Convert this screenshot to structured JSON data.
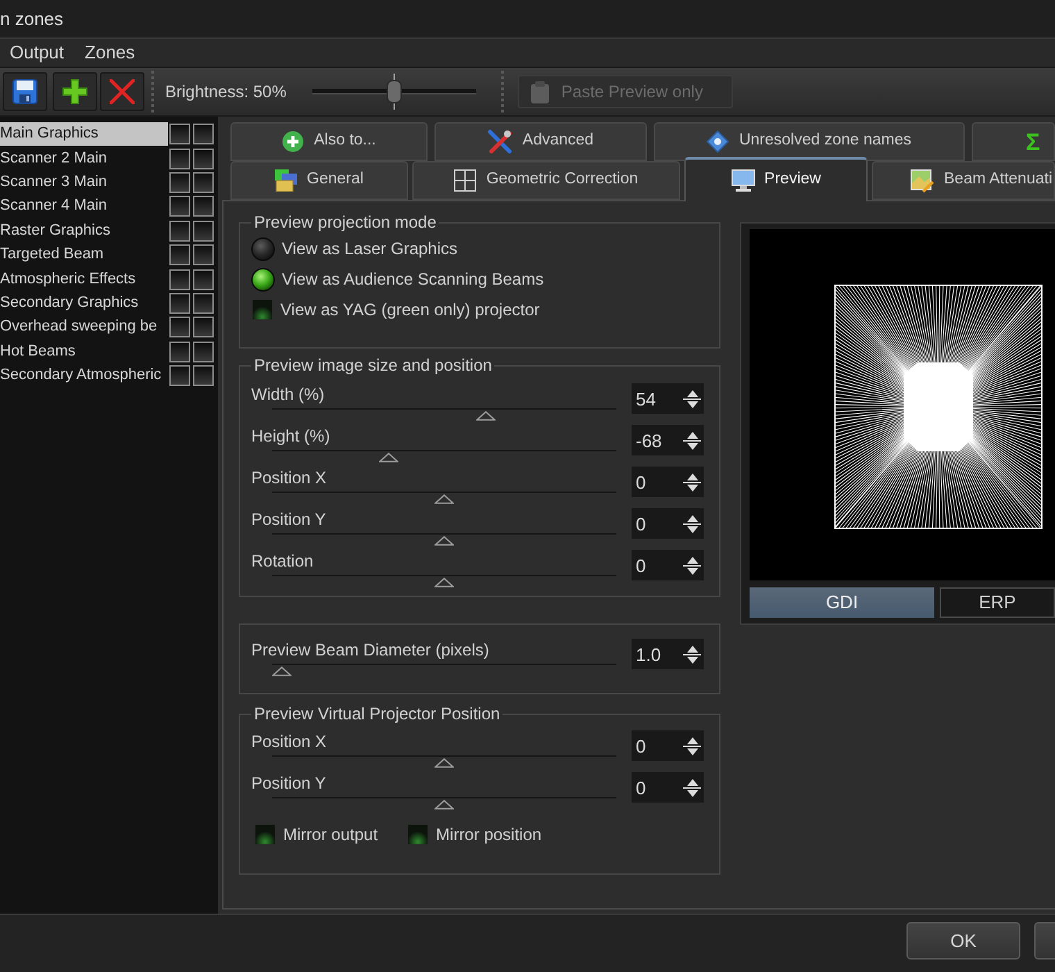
{
  "window": {
    "title": "n zones"
  },
  "menu": [
    "Output",
    "Zones"
  ],
  "toolbar": {
    "brightness": {
      "label": "Brightness: 50%",
      "level": 0.5
    },
    "paste_button": {
      "label": "Paste Preview only",
      "disabled": true
    }
  },
  "zones": [
    {
      "name": "Main Graphics",
      "selected": true,
      "checks": [
        false,
        false
      ]
    },
    {
      "name": "Scanner 2 Main",
      "selected": false,
      "checks": [
        false,
        false
      ]
    },
    {
      "name": "Scanner 3 Main",
      "selected": false,
      "checks": [
        false,
        false
      ]
    },
    {
      "name": "Scanner 4 Main",
      "selected": false,
      "checks": [
        false,
        false
      ]
    },
    {
      "name": "Raster Graphics",
      "selected": false,
      "checks": [
        false,
        false
      ]
    },
    {
      "name": "Targeted Beam",
      "selected": false,
      "checks": [
        false,
        false
      ]
    },
    {
      "name": "Atmospheric Effects",
      "selected": false,
      "checks": [
        false,
        false
      ]
    },
    {
      "name": "Secondary Graphics",
      "selected": false,
      "checks": [
        false,
        false
      ]
    },
    {
      "name": "Overhead sweeping be",
      "selected": false,
      "checks": [
        false,
        false
      ]
    },
    {
      "name": "Hot Beams",
      "selected": false,
      "checks": [
        false,
        false
      ]
    },
    {
      "name": "Secondary Atmospheric",
      "selected": false,
      "checks": [
        false,
        false
      ]
    }
  ],
  "tabs_row_1": [
    {
      "kind": "text",
      "label": "Also to...",
      "selected": false
    },
    {
      "kind": "text",
      "label": "Advanced",
      "selected": false
    },
    {
      "kind": "text",
      "label": "Unresolved zone names",
      "selected": false
    },
    {
      "kind": "symbol",
      "label": "Σ",
      "selected": false
    }
  ],
  "tabs_row_2": [
    {
      "label": "General",
      "selected": false
    },
    {
      "label": "Geometric Correction",
      "selected": false
    },
    {
      "label": "Preview",
      "selected": true
    },
    {
      "label": "Beam Attenuati",
      "selected": false
    }
  ],
  "projection_mode": {
    "title": "Preview projection mode",
    "options": [
      {
        "kind": "radio",
        "label": "View as Laser Graphics",
        "selected": false
      },
      {
        "kind": "radio",
        "label": "View as Audience Scanning Beams",
        "selected": true
      },
      {
        "kind": "checkbox",
        "label": "View as YAG (green only) projector",
        "checked": false
      }
    ]
  },
  "image_size": {
    "title": "Preview image size and position",
    "rows": [
      {
        "label": "Width (%)",
        "value": "54",
        "level": 0.63
      },
      {
        "label": "Height (%)",
        "value": "-68",
        "level": 0.33
      },
      {
        "label": "Position X",
        "value": "0",
        "level": 0.5
      },
      {
        "label": "Position Y",
        "value": "0",
        "level": 0.5
      },
      {
        "label": "Rotation",
        "value": "0",
        "level": 0.5
      }
    ]
  },
  "beam_diameter": {
    "rows": [
      {
        "label": "Preview Beam Diameter (pixels)",
        "value": "1.0",
        "level": 0
      }
    ]
  },
  "projector_position": {
    "title": "Preview Virtual Projector Position",
    "rows": [
      {
        "label": "Position X",
        "value": "0",
        "level": 0.5
      },
      {
        "label": "Position Y",
        "value": "0",
        "level": 0.5
      }
    ],
    "checkboxes": [
      {
        "label": "Mirror output",
        "checked": false
      },
      {
        "label": "Mirror position",
        "checked": false
      }
    ]
  },
  "renderer": [
    {
      "label": "GDI",
      "selected": true
    },
    {
      "label": "ERP",
      "selected": false
    }
  ],
  "buttons": [
    {
      "kind": "full",
      "label": "OK"
    },
    {
      "kind": "clipped"
    }
  ]
}
